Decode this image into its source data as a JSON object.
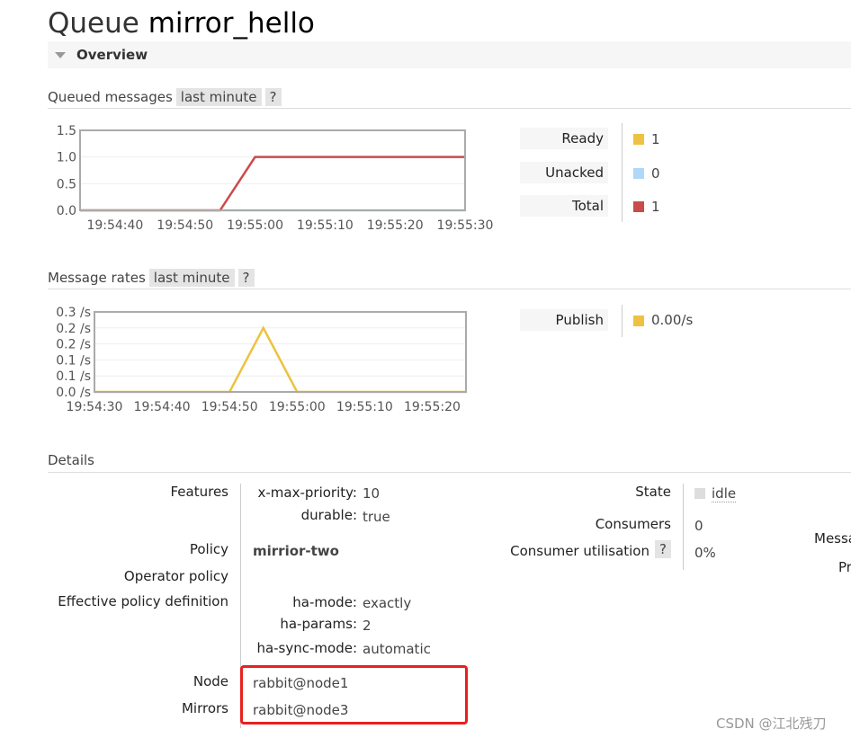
{
  "title": {
    "prefix": "Queue",
    "name": "mirror_hello"
  },
  "overview": {
    "label": "Overview"
  },
  "queued": {
    "label": "Queued messages",
    "range": "last minute",
    "help": "?",
    "legend": [
      {
        "label": "Ready",
        "value": "1",
        "color": "#edc240"
      },
      {
        "label": "Unacked",
        "value": "0",
        "color": "#afd8f8"
      },
      {
        "label": "Total",
        "value": "1",
        "color": "#cb4b4b"
      }
    ]
  },
  "rates": {
    "label": "Message rates",
    "range": "last minute",
    "help": "?",
    "legend": [
      {
        "label": "Publish",
        "value": "0.00/s",
        "color": "#edc240"
      }
    ]
  },
  "chart_data": [
    {
      "type": "line",
      "yticks": [
        "1.5",
        "1.0",
        "0.5",
        "0.0"
      ],
      "ylim": [
        0,
        1.5
      ],
      "xticks": [
        "19:54:40",
        "19:54:50",
        "19:55:00",
        "19:55:10",
        "19:55:20",
        "19:55:30"
      ],
      "xlim": [
        "19:54:35",
        "19:55:30"
      ],
      "series": [
        {
          "name": "Total",
          "color": "#cb4b4b",
          "x": [
            "19:54:35",
            "19:54:55",
            "19:55:00",
            "19:55:30"
          ],
          "y": [
            0,
            0,
            1,
            1
          ]
        },
        {
          "name": "Unacked",
          "color": "#afd8f8",
          "x": [
            "19:54:55",
            "19:55:30"
          ],
          "y": [
            0,
            0
          ]
        }
      ]
    },
    {
      "type": "line",
      "yticks": [
        "0.3 /s",
        "0.2 /s",
        "0.2 /s",
        "0.1 /s",
        "0.1 /s",
        "0.0 /s"
      ],
      "ylim": [
        0,
        0.25
      ],
      "xticks": [
        "19:54:30",
        "19:54:40",
        "19:54:50",
        "19:55:00",
        "19:55:10",
        "19:55:20"
      ],
      "xlim": [
        "19:54:30",
        "19:55:25"
      ],
      "series": [
        {
          "name": "Publish",
          "color": "#edc240",
          "x": [
            "19:54:30",
            "19:54:50",
            "19:54:55",
            "19:55:00",
            "19:55:25"
          ],
          "y": [
            0,
            0,
            0.2,
            0,
            0
          ]
        }
      ]
    }
  ],
  "details": {
    "label": "Details",
    "features_label": "Features",
    "features": [
      {
        "k": "x-max-priority:",
        "v": "10"
      },
      {
        "k": "durable:",
        "v": "true"
      }
    ],
    "policy_label": "Policy",
    "policy": "mirrior-two",
    "operator_policy_label": "Operator policy",
    "effective_label": "Effective policy definition",
    "effective": [
      {
        "k": "ha-mode:",
        "v": "exactly"
      },
      {
        "k": "ha-params:",
        "v": "2"
      },
      {
        "k": "ha-sync-mode:",
        "v": "automatic"
      }
    ],
    "node_label": "Node",
    "node": "rabbit@node1",
    "mirrors_label": "Mirrors",
    "mirrors": "rabbit@node3",
    "state_label": "State",
    "state": "idle",
    "consumers_label": "Consumers",
    "consumers": "0",
    "util_label": "Consumer utilisation",
    "util_help": "?",
    "util": "0%",
    "cut1": "Messa",
    "cut2": "Pr"
  },
  "watermark": "CSDN @江北残刀"
}
